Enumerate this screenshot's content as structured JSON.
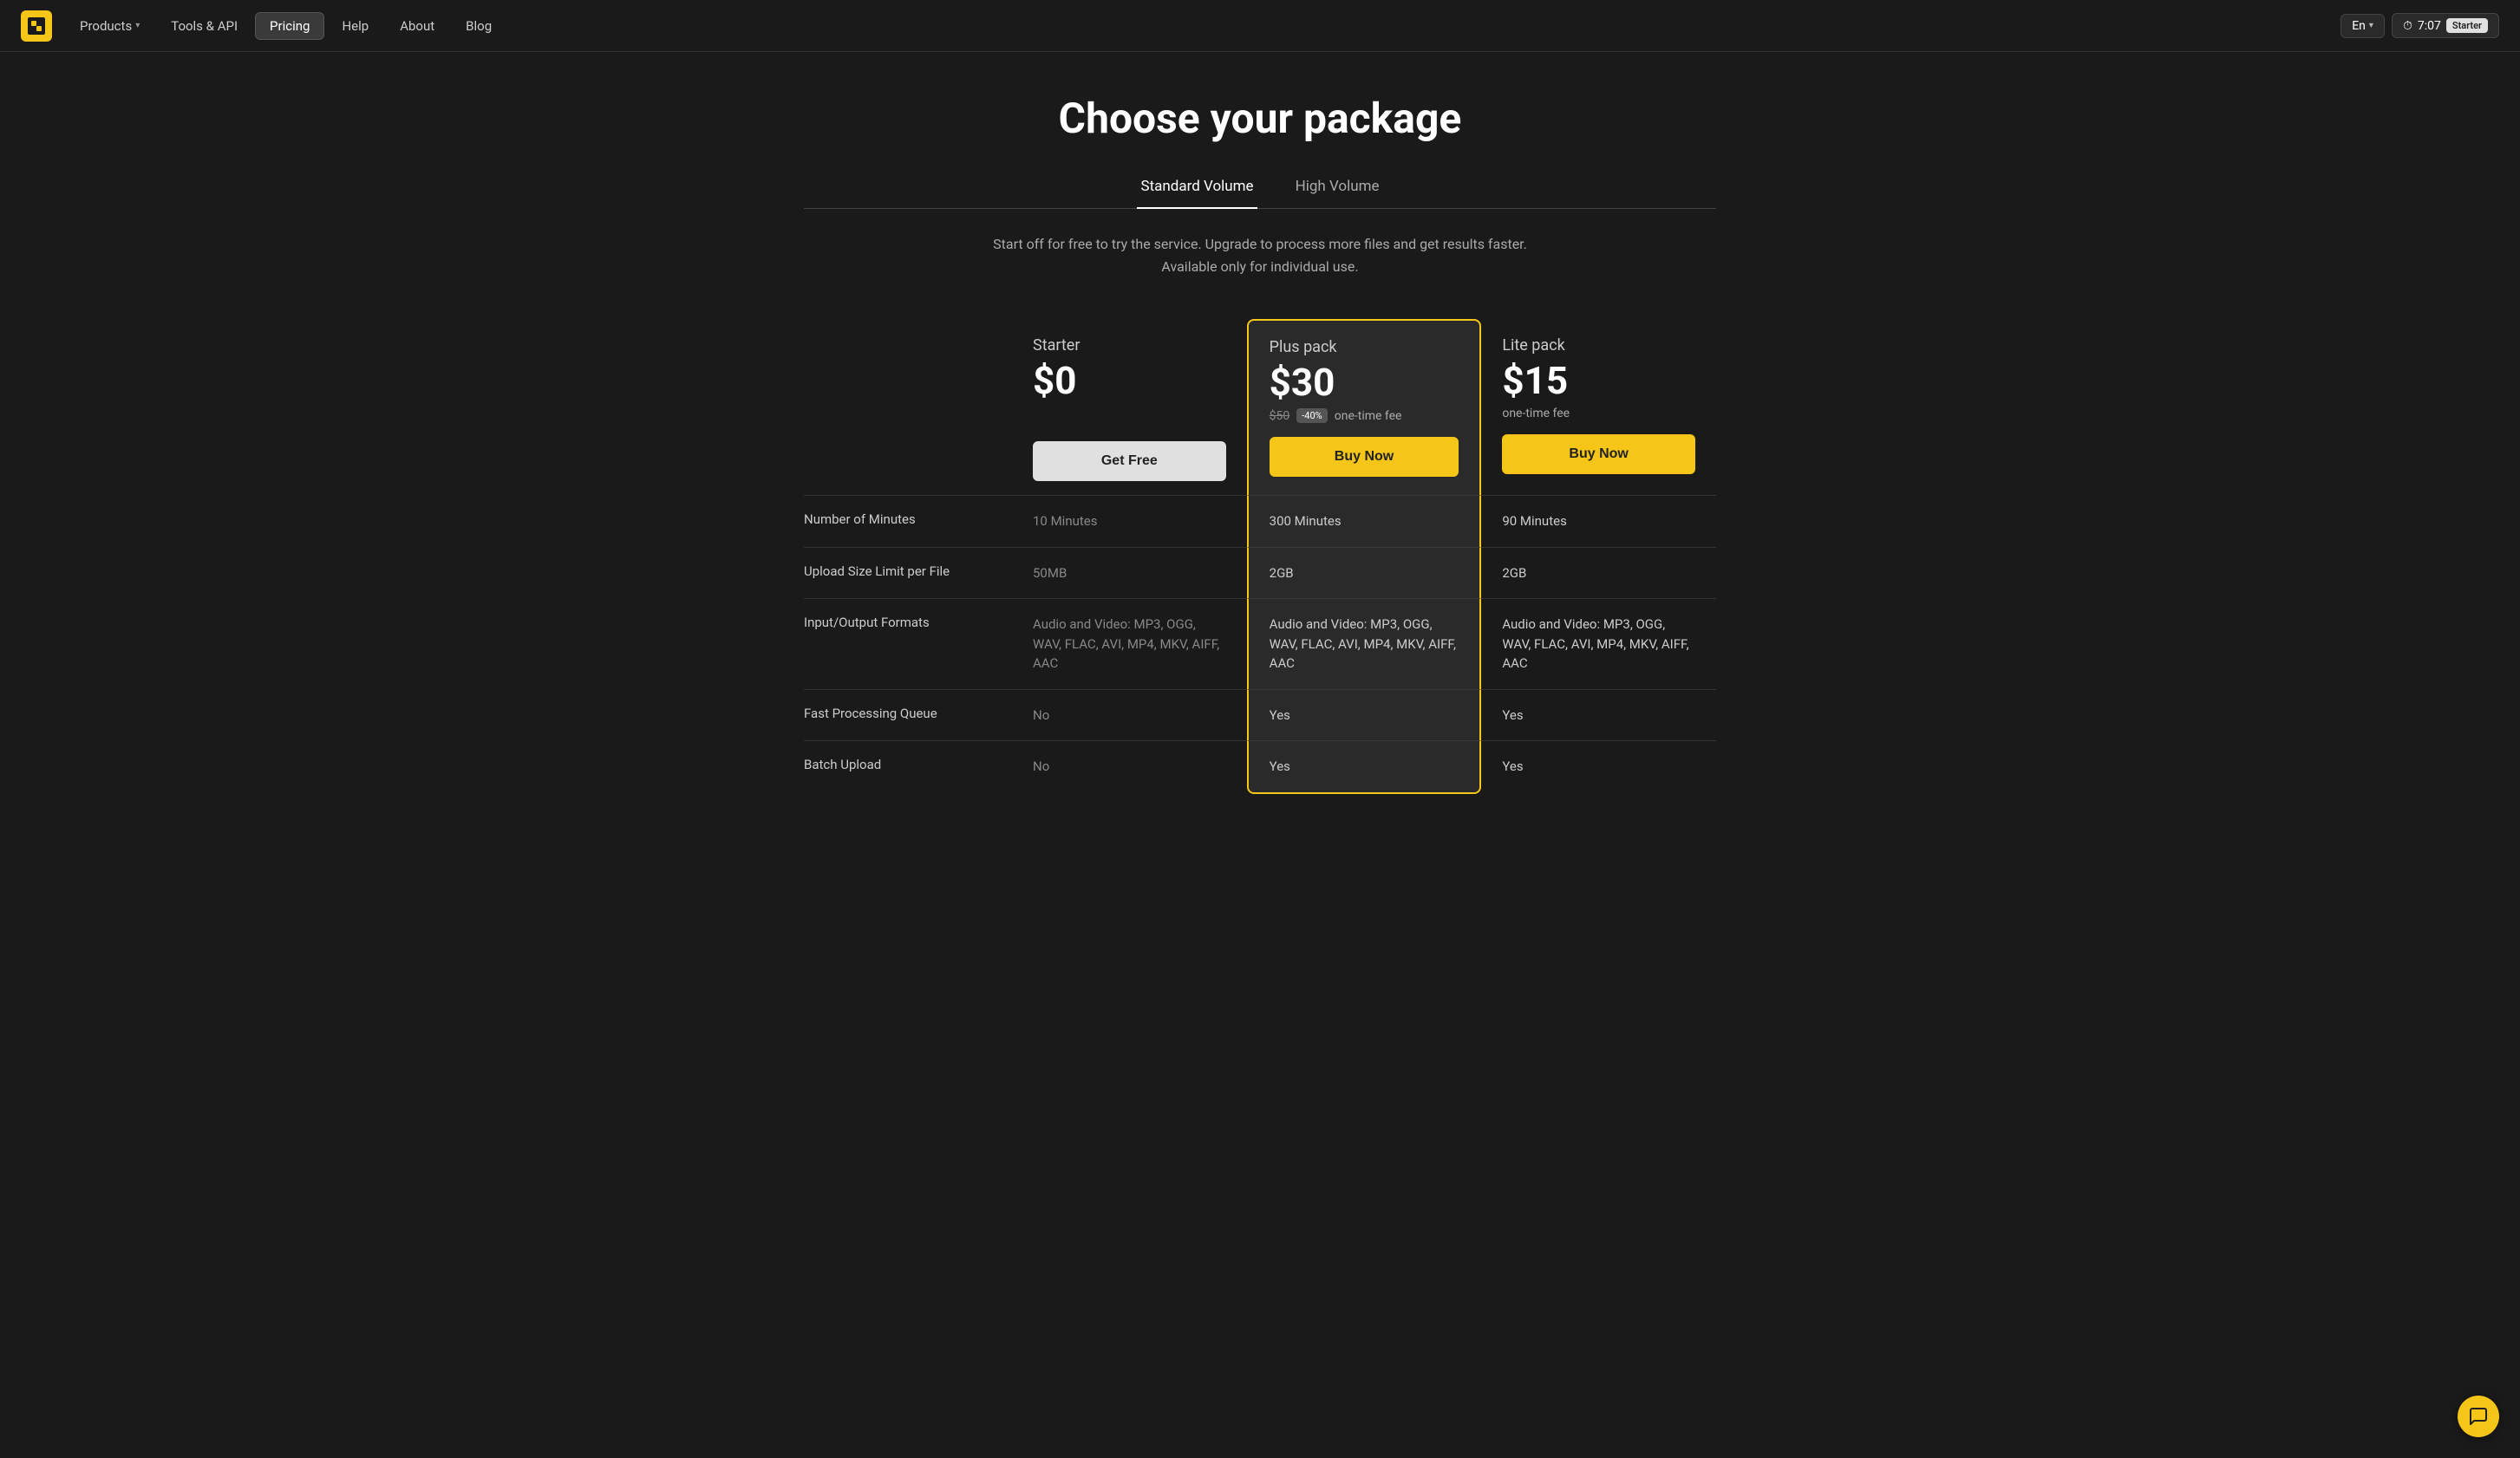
{
  "nav": {
    "logo_alt": "App Logo",
    "items": [
      {
        "label": "Products",
        "has_dropdown": true,
        "active": false
      },
      {
        "label": "Tools & API",
        "has_dropdown": false,
        "active": false
      },
      {
        "label": "Pricing",
        "has_dropdown": false,
        "active": true
      },
      {
        "label": "Help",
        "has_dropdown": false,
        "active": false
      },
      {
        "label": "About",
        "has_dropdown": false,
        "active": false
      },
      {
        "label": "Blog",
        "has_dropdown": false,
        "active": false
      }
    ],
    "lang": "En",
    "timer": "7:07",
    "starter_badge": "Starter"
  },
  "page": {
    "title": "Choose your package",
    "tabs": [
      {
        "label": "Standard Volume",
        "active": true
      },
      {
        "label": "High Volume",
        "active": false
      }
    ],
    "subtitle": "Start off for free to try the service. Upgrade to process more files and get results faster. Available only for individual use."
  },
  "plans": {
    "starter": {
      "name": "Starter",
      "price": "$0",
      "cta": "Get Free"
    },
    "plus": {
      "name": "Plus pack",
      "price": "$30",
      "original_price": "$50",
      "discount": "-40%",
      "fee_label": "one-time fee",
      "cta": "Buy Now"
    },
    "lite": {
      "name": "Lite pack",
      "price": "$15",
      "fee_label": "one-time fee",
      "cta": "Buy Now"
    }
  },
  "features": [
    {
      "label": "Number of Minutes",
      "starter": "10 Minutes",
      "plus": "300 Minutes",
      "lite": "90 Minutes"
    },
    {
      "label": "Upload Size Limit per File",
      "starter": "50MB",
      "plus": "2GB",
      "lite": "2GB"
    },
    {
      "label": "Input/Output Formats",
      "starter": "Audio and Video: MP3, OGG, WAV, FLAC, AVI, MP4, MKV, AIFF, AAC",
      "plus": "Audio and Video: MP3, OGG, WAV, FLAC, AVI, MP4, MKV, AIFF, AAC",
      "lite": "Audio and Video: MP3, OGG, WAV, FLAC, AVI, MP4, MKV, AIFF, AAC"
    },
    {
      "label": "Fast Processing Queue",
      "starter": "No",
      "plus": "Yes",
      "lite": "Yes"
    },
    {
      "label": "Batch Upload",
      "starter": "No",
      "plus": "Yes",
      "lite": "Yes"
    }
  ]
}
